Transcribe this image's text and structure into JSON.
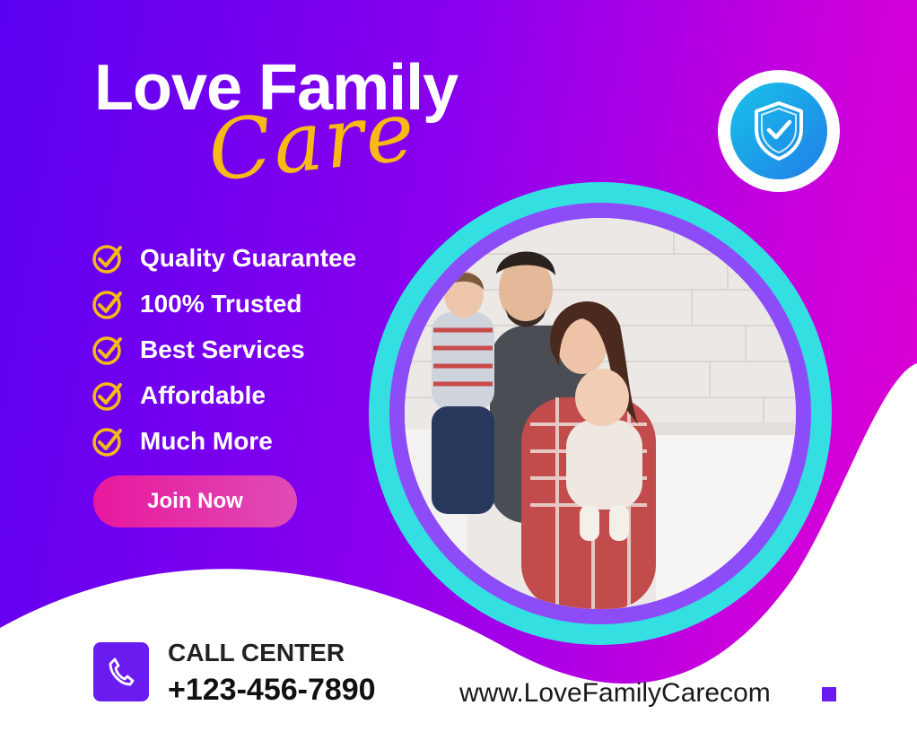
{
  "header": {
    "title": "Love Family",
    "script": "Care"
  },
  "features": [
    {
      "label": "Quality Guarantee",
      "icon": "check-circle-icon"
    },
    {
      "label": "100% Trusted",
      "icon": "check-circle-icon"
    },
    {
      "label": "Best Services",
      "icon": "check-circle-icon"
    },
    {
      "label": "Affordable",
      "icon": "check-circle-icon"
    },
    {
      "label": "Much More",
      "icon": "check-circle-icon"
    }
  ],
  "cta": {
    "label": "Join Now"
  },
  "badge": {
    "icon": "shield-check-icon"
  },
  "contact": {
    "label": "CALL CENTER",
    "phone": "+123-456-7890",
    "icon": "phone-icon"
  },
  "website": "www.LoveFamilyCarecom",
  "colors": {
    "accent": "#f7b916",
    "primary": "#6a1cf0",
    "pink": "#e8189c",
    "cyan": "#34dfe1"
  }
}
